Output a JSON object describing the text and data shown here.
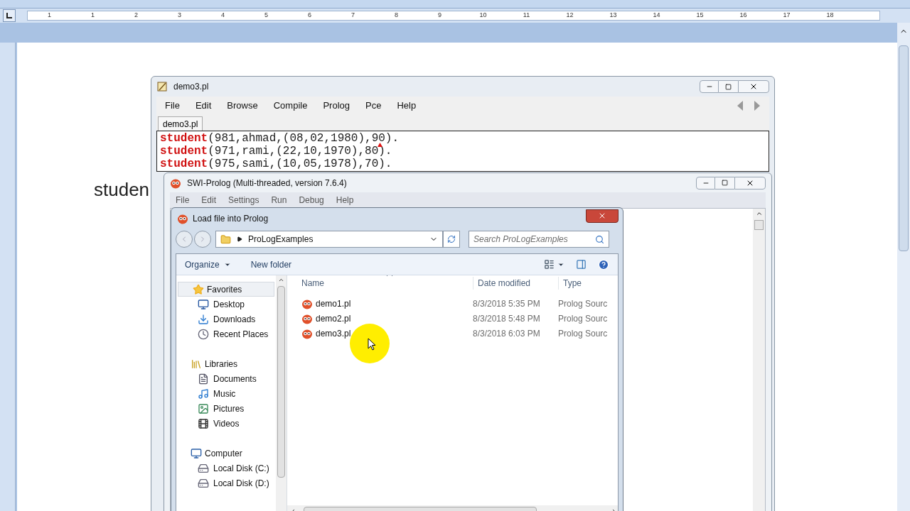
{
  "word": {
    "ruler_numbers": [
      "1",
      "1",
      "2",
      "3",
      "4",
      "5",
      "6",
      "7",
      "8",
      "9",
      "10",
      "11",
      "12",
      "13",
      "14",
      "15",
      "16",
      "17",
      "18"
    ],
    "document_text": "studen"
  },
  "editor": {
    "title": "demo3.pl",
    "menu": [
      "File",
      "Edit",
      "Browse",
      "Compile",
      "Prolog",
      "Pce",
      "Help"
    ],
    "tabs": [
      {
        "label": "demo3.pl",
        "selected": true
      }
    ],
    "lines": [
      {
        "keyword": "student",
        "rest": "(981,ahmad,(08,02,1980),90)."
      },
      {
        "keyword": "student",
        "rest": "(971,rami,(22,10,1970),80)."
      },
      {
        "keyword": "student",
        "rest": "(975,sami,(10,05,1978),70)."
      }
    ]
  },
  "console": {
    "title": "SWI-Prolog (Multi-threaded, version 7.6.4)",
    "menu": [
      "File",
      "Edit",
      "Settings",
      "Run",
      "Debug",
      "Help"
    ]
  },
  "dialog": {
    "title": "Load file into Prolog",
    "path": "ProLogExamples",
    "search": {
      "placeholder": "Search ProLogExamples"
    },
    "toolbar": [
      {
        "label": "Organize",
        "kind": "menu"
      },
      {
        "label": "New folder",
        "kind": "button"
      }
    ],
    "nav": [
      {
        "label": "Favorites",
        "kind": "favorites",
        "children": [
          {
            "label": "Desktop",
            "kind": "desktop"
          },
          {
            "label": "Downloads",
            "kind": "downloads"
          },
          {
            "label": "Recent Places",
            "kind": "recent"
          }
        ]
      },
      {
        "label": "Libraries",
        "kind": "libraries",
        "children": [
          {
            "label": "Documents",
            "kind": "documents"
          },
          {
            "label": "Music",
            "kind": "music"
          },
          {
            "label": "Pictures",
            "kind": "pictures"
          },
          {
            "label": "Videos",
            "kind": "videos"
          }
        ]
      },
      {
        "label": "Computer",
        "kind": "computer",
        "children": [
          {
            "label": "Local Disk (C:)",
            "kind": "disk"
          },
          {
            "label": "Local Disk (D:)",
            "kind": "disk"
          }
        ]
      }
    ],
    "columns": [
      "Name",
      "Date modified",
      "Type"
    ],
    "files": [
      {
        "name": "demo1.pl",
        "date": "8/3/2018 5:35 PM",
        "type": "Prolog Sourc",
        "selected": false
      },
      {
        "name": "demo2.pl",
        "date": "8/3/2018 5:48 PM",
        "type": "Prolog Sourc",
        "selected": false
      },
      {
        "name": "demo3.pl",
        "date": "8/3/2018 6:03 PM",
        "type": "Prolog Sourc",
        "selected": false
      }
    ]
  }
}
